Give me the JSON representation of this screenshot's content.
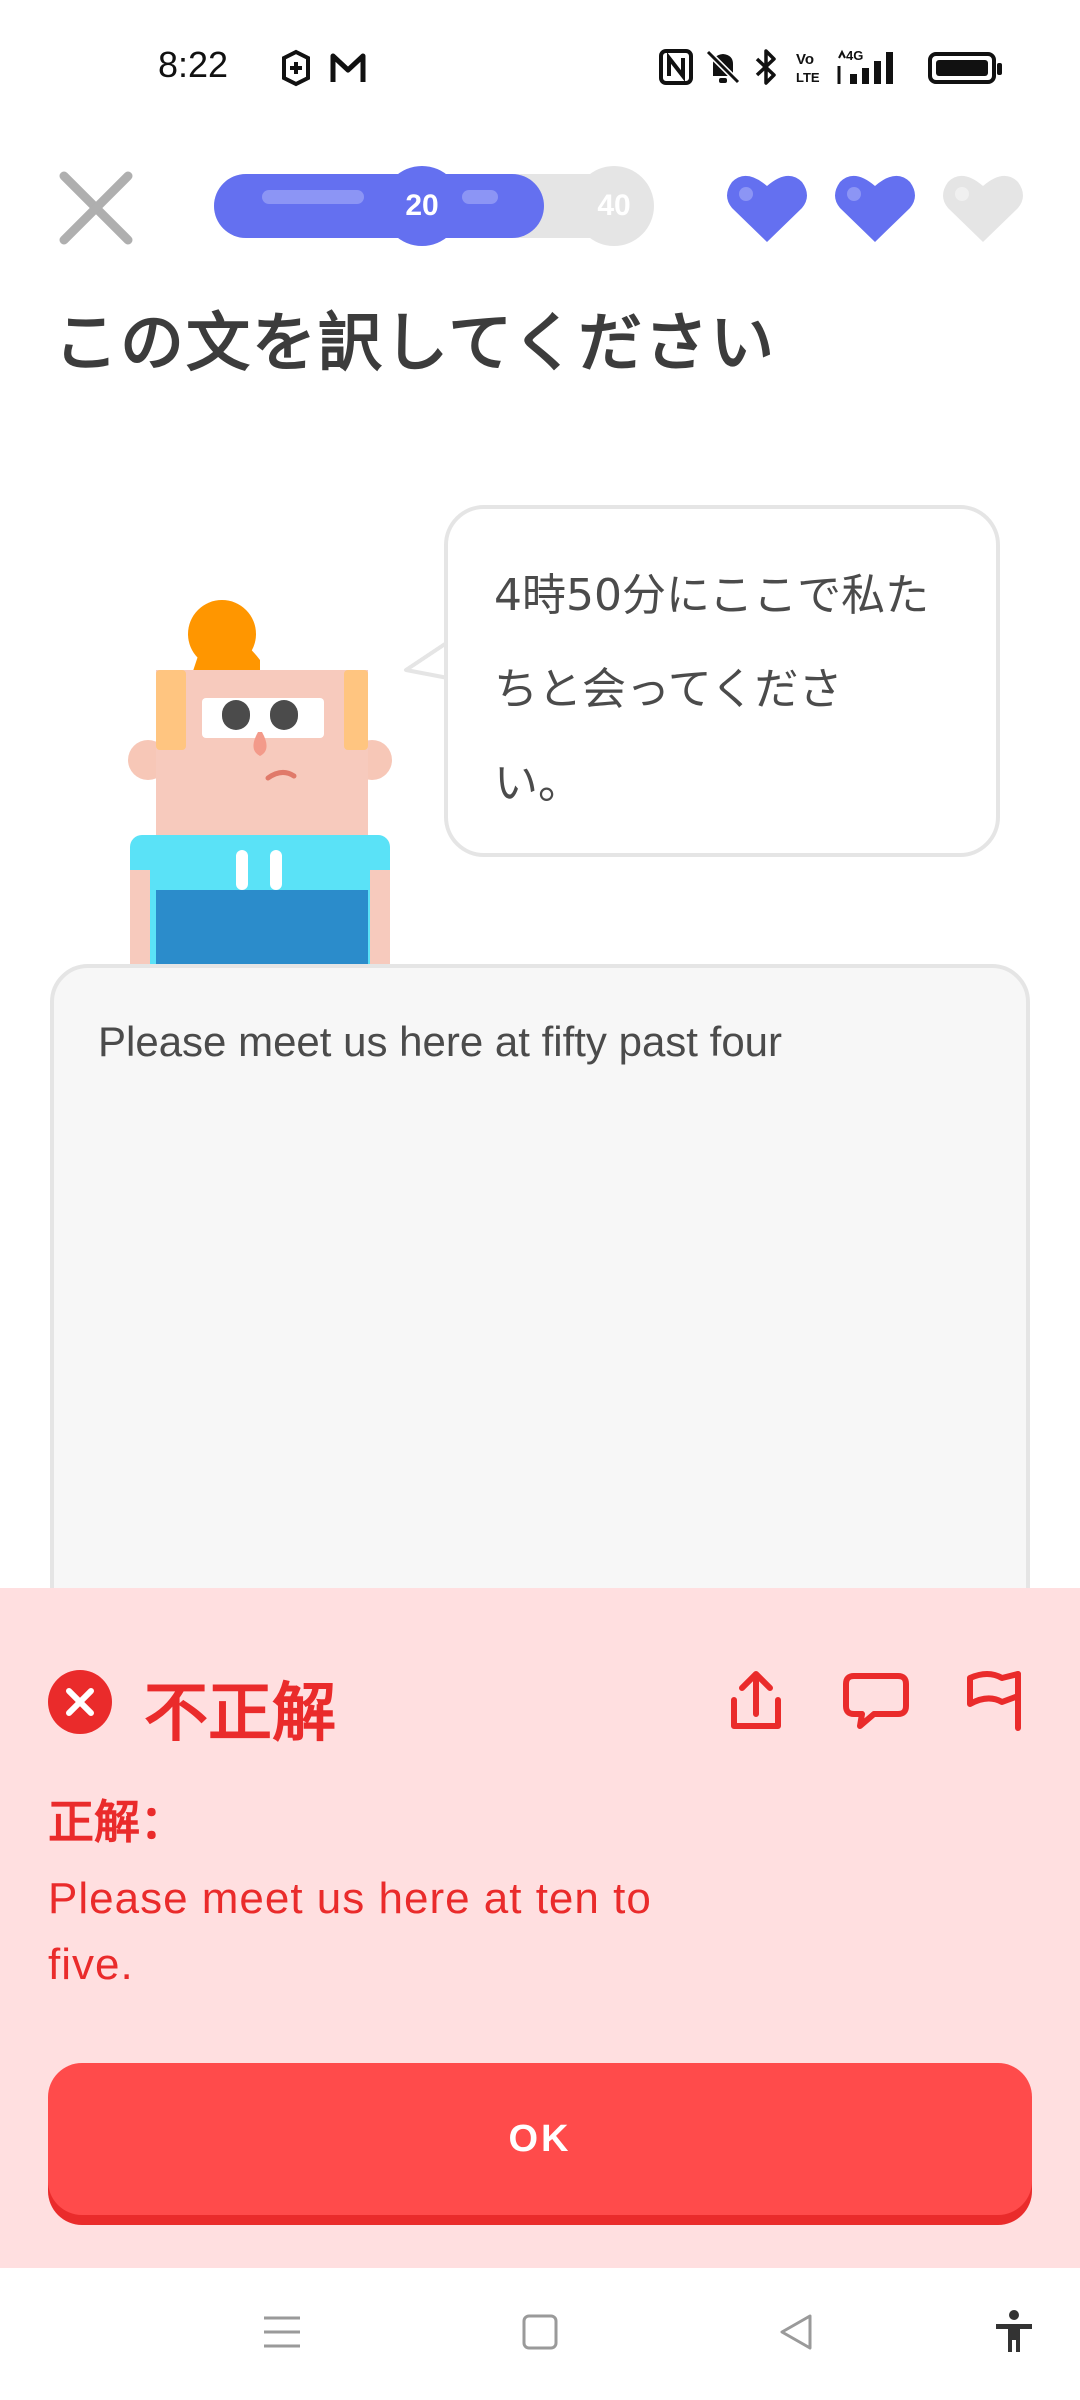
{
  "status_bar": {
    "time": "8:22",
    "left_icons": [
      "sync-app-icon",
      "gmail-icon"
    ],
    "right_icons": [
      "nfc-icon",
      "silent-icon",
      "bluetooth-icon",
      "volte-icon",
      "4g-signal-icon",
      "battery-icon"
    ],
    "network": "4G"
  },
  "header": {
    "close_icon": "close-icon",
    "progress": {
      "fraction": 0.5,
      "marker_current": "20",
      "marker_next": "40"
    },
    "hearts": [
      {
        "state": "full",
        "color": "#6470f0"
      },
      {
        "state": "full",
        "color": "#6470f0"
      },
      {
        "state": "empty",
        "color": "#e5e5e5"
      }
    ]
  },
  "exercise": {
    "instruction": "この文を訳してください",
    "prompt_lines": [
      "4時50分にここで私た",
      "ちと会ってくださ",
      "い。"
    ],
    "user_answer": "Please meet us here at fifty past four"
  },
  "feedback": {
    "status": "不正解",
    "status_icon": "x-circle-icon",
    "actions": [
      "share-icon",
      "comment-icon",
      "flag-icon"
    ],
    "correct_label": "正解：",
    "correct_answer": "Please meet us here at ten to five.",
    "ok_label": "OK",
    "colors": {
      "background": "#ffdfe0",
      "text": "#ea2b2b",
      "button": "#ff4b4b"
    }
  },
  "nav_bar": {
    "buttons": [
      "menu-icon",
      "home-icon",
      "back-icon",
      "accessibility-icon"
    ]
  }
}
